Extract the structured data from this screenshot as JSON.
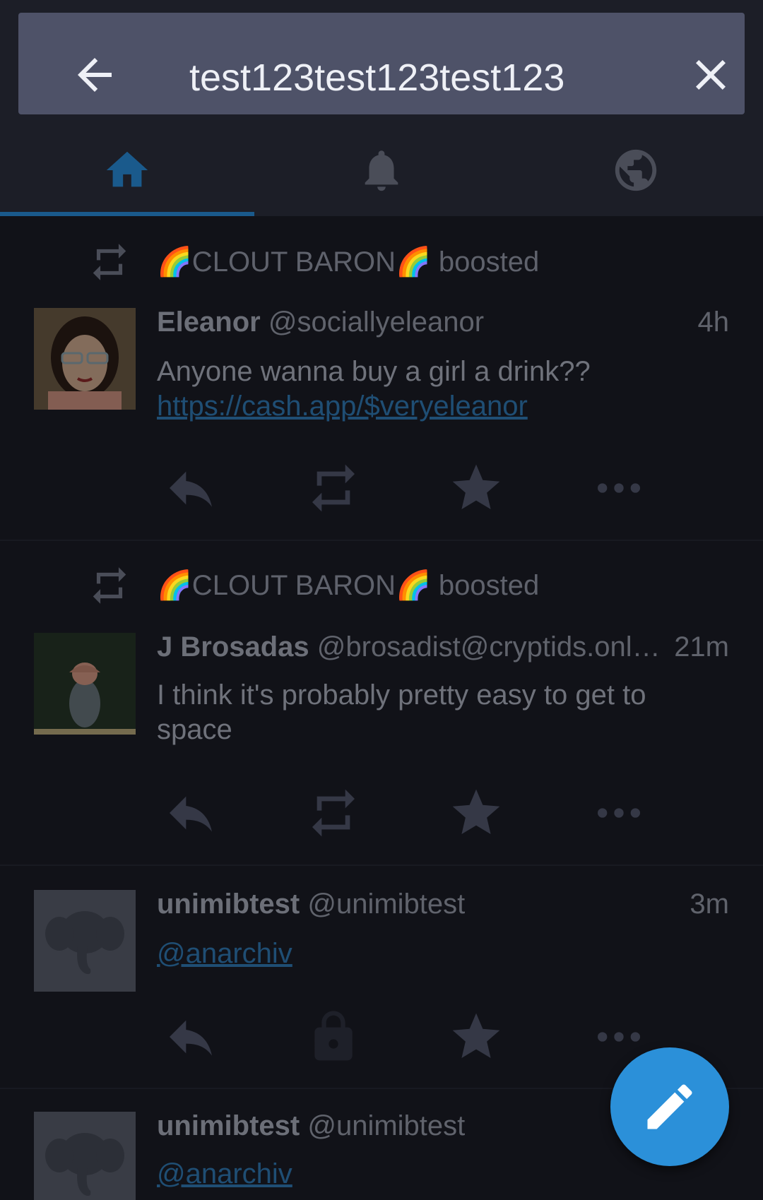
{
  "search": {
    "query": "test123test123test123"
  },
  "tabs": [
    {
      "name": "home-icon",
      "active": true
    },
    {
      "name": "bell-icon",
      "active": false
    },
    {
      "name": "globe-icon",
      "active": false
    }
  ],
  "statuses": [
    {
      "boosted_by": "🌈CLOUT BARON🌈 boosted",
      "display_name": "Eleanor",
      "handle": "@sociallyeleanor",
      "time": "4h",
      "text": "Anyone wanna buy a girl a drink?? ",
      "link": "https://cash.app/$veryeleanor",
      "actions": [
        "reply-icon",
        "boost-icon",
        "star-icon",
        "more-icon"
      ]
    },
    {
      "boosted_by": "🌈CLOUT BARON🌈 boosted",
      "display_name": "J Brosadas",
      "handle": "@brosadist@cryptids.onl…",
      "time": "21m",
      "text": "I think it's probably pretty easy to get to space",
      "actions": [
        "reply-icon",
        "boost-icon",
        "star-icon",
        "more-icon"
      ]
    },
    {
      "display_name": "unimibtest",
      "handle": "@unimibtest",
      "time": "3m",
      "mention": "@anarchiv",
      "actions": [
        "reply-icon",
        "lock-icon",
        "star-icon",
        "more-icon"
      ]
    },
    {
      "display_name": "unimibtest",
      "handle": "@unimibtest",
      "mention": "@anarchiv"
    }
  ],
  "colors": {
    "accent": "#2b90d9",
    "link": "#1f4e74",
    "tab_active": "#1a5a8c"
  },
  "fab": {
    "icon": "pencil-icon"
  }
}
